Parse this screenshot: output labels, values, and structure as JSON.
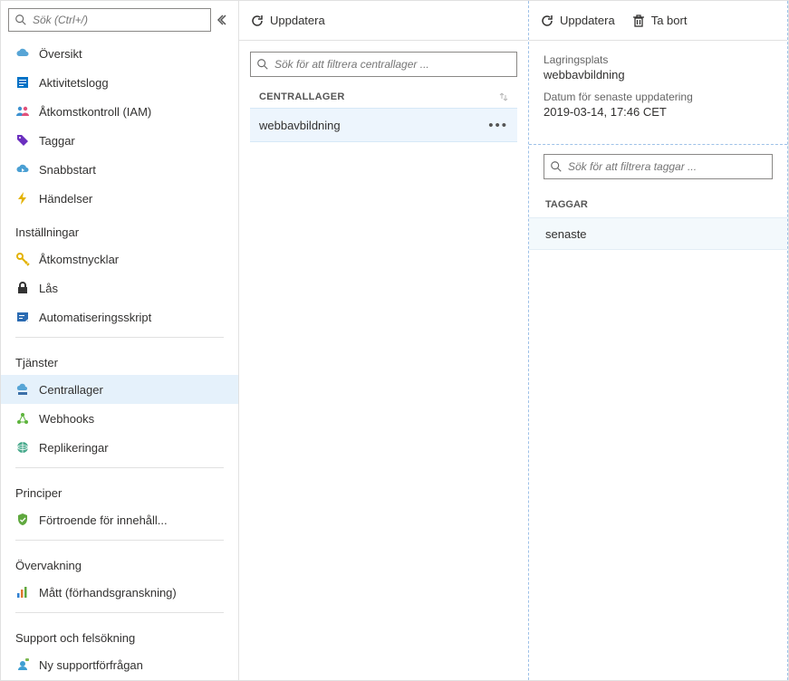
{
  "sidebar": {
    "search_placeholder": "Sök (Ctrl+/)",
    "top_items": [
      {
        "label": "Översikt",
        "icon": "cloud",
        "color": "#57A5D6"
      },
      {
        "label": "Aktivitetslogg",
        "icon": "log",
        "color": "#0072C6"
      },
      {
        "label": "Åtkomstkontroll (IAM)",
        "icon": "people",
        "color": "#E2507A"
      },
      {
        "label": "Taggar",
        "icon": "tag",
        "color": "#6B2FBF"
      },
      {
        "label": "Snabbstart",
        "icon": "quickstart",
        "color": "#4A9FD3"
      },
      {
        "label": "Händelser",
        "icon": "bolt",
        "color": "#E3B200"
      }
    ],
    "sections": [
      {
        "title": "Inställningar",
        "items": [
          {
            "label": "Åtkomstnycklar",
            "icon": "key",
            "color": "#E3B200"
          },
          {
            "label": "Lås",
            "icon": "lock",
            "color": "#333"
          },
          {
            "label": "Automatiseringsskript",
            "icon": "script",
            "color": "#2B6BB2"
          }
        ]
      },
      {
        "title": "Tjänster",
        "items": [
          {
            "label": "Centrallager",
            "icon": "cloudtray",
            "color": "#57A5D6",
            "selected": true
          },
          {
            "label": "Webhooks",
            "icon": "webhook",
            "color": "#5DB43C"
          },
          {
            "label": "Replikeringar",
            "icon": "globe",
            "color": "#45A88A"
          }
        ]
      },
      {
        "title": "Principer",
        "items": [
          {
            "label": "Förtroende för innehåll...",
            "icon": "shield",
            "color": "#5FA83E"
          }
        ]
      },
      {
        "title": "Övervakning",
        "items": [
          {
            "label": "Mått (förhandsgranskning)",
            "icon": "metrics",
            "color": "#2F7FD0"
          }
        ]
      },
      {
        "title": "Support och felsökning",
        "items": [
          {
            "label": "Ny supportförfrågan",
            "icon": "support",
            "color": "#3E9FD2"
          }
        ]
      }
    ]
  },
  "middle": {
    "refresh_label": "Uppdatera",
    "filter_placeholder": "Sök för att filtrera centrallager ...",
    "column_header": "CENTRALLAGER",
    "rows": [
      {
        "name": "webbavbildning"
      }
    ]
  },
  "right": {
    "refresh_label": "Uppdatera",
    "delete_label": "Ta bort",
    "location_label": "Lagringsplats",
    "location_value": "webbavbildning",
    "updated_label": "Datum för senaste uppdatering",
    "updated_value": "2019-03-14, 17:46 CET",
    "tag_filter_placeholder": "Sök för att filtrera taggar ...",
    "tag_column_header": "TAGGAR",
    "tags": [
      {
        "name": "senaste"
      }
    ]
  }
}
